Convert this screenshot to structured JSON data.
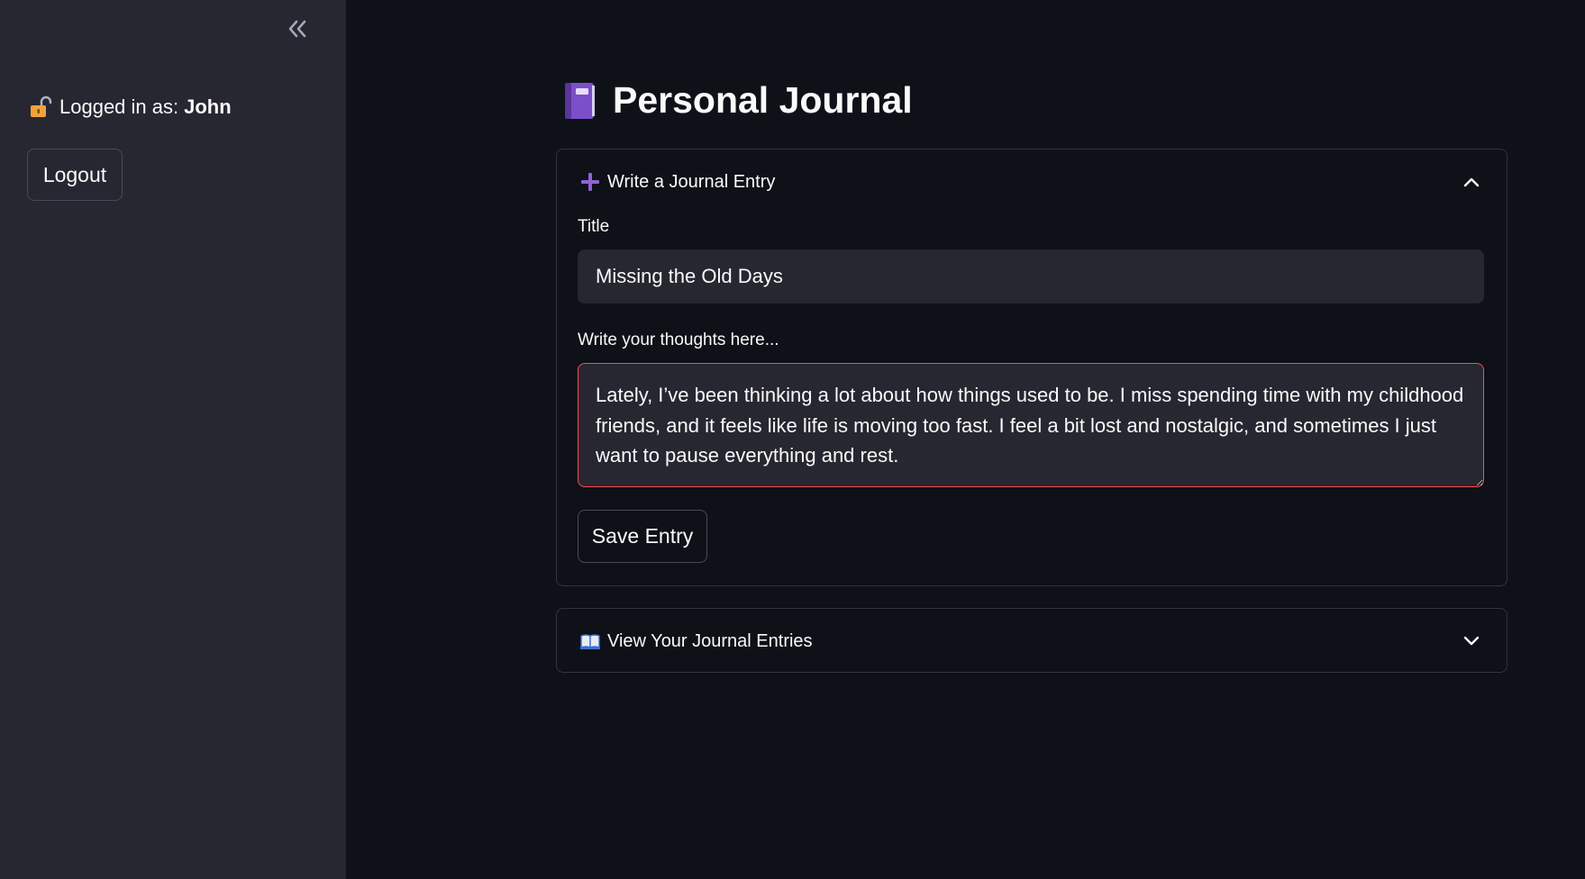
{
  "sidebar": {
    "collapse_icon": "double-chevron-left-icon",
    "login_icon": "unlocked-padlock-icon",
    "login_prefix": "Logged in as:",
    "username": "John",
    "logout_label": "Logout"
  },
  "main": {
    "title_icon": "purple-notebook-icon",
    "title": "Personal Journal",
    "write_expander": {
      "icon": "plus-icon",
      "label": "Write a Journal Entry",
      "expanded": true,
      "title_label": "Title",
      "title_value": "Missing the Old Days",
      "thoughts_label": "Write your thoughts here...",
      "thoughts_value": "Lately, I’ve been thinking a lot about how things used to be. I miss spending time with my childhood friends, and it feels like life is moving too fast. I feel a bit lost and nostalgic, and sometimes I just want to pause everything and rest.",
      "save_label": "Save Entry"
    },
    "view_expander": {
      "icon": "open-book-icon",
      "label": "View Your Journal Entries",
      "expanded": false
    }
  },
  "colors": {
    "sidebar_bg": "#262730",
    "main_bg": "#0e1117",
    "input_bg": "#262730",
    "focus_border": "#ff4b4b",
    "accent_purple": "#7b4fc9"
  }
}
